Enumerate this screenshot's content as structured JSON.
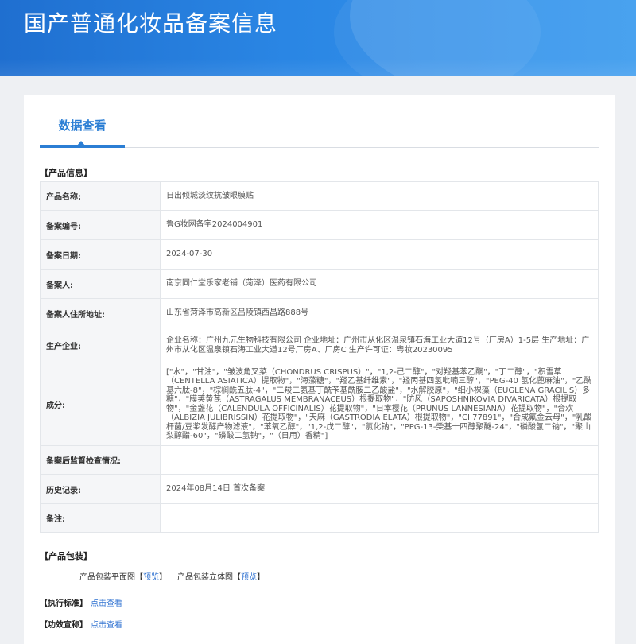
{
  "header": {
    "title": "国产普通化妆品备案信息"
  },
  "tabs": [
    {
      "label": "数据查看"
    }
  ],
  "product_info": {
    "section_title": "【产品信息】",
    "rows": [
      {
        "label": "产品名称:",
        "value": "日出倾城淡纹抗皱眼膜贴"
      },
      {
        "label": "备案编号:",
        "value": "鲁G妆网备字2024004901"
      },
      {
        "label": "备案日期:",
        "value": "2024-07-30"
      },
      {
        "label": "备案人:",
        "value": "南京同仁堂乐家老铺（菏泽）医药有限公司"
      },
      {
        "label": "备案人住所地址:",
        "value": "山东省菏泽市高新区吕陵镇西昌路888号"
      },
      {
        "label": "生产企业:",
        "value": "企业名称：广州九元生物科技有限公司 企业地址：广州市从化区温泉镇石海工业大道12号（厂房A）1-5层 生产地址：广州市从化区温泉镇石海工业大道12号厂房A、厂房C 生产许可证：粤妆20230095"
      },
      {
        "label": "成分:",
        "value": "[\"水\"，\"甘油\"，\"皱波角叉菜（CHONDRUS CRISPUS）\"，\"1,2-己二醇\"，\"对羟基苯乙酮\"，\"丁二醇\"，\"积雪草（CENTELLA ASIATICA）提取物\"，\"海藻糖\"，\"羟乙基纤维素\"，\"羟丙基四氢吡喃三醇\"，\"PEG-40 氢化蓖麻油\"，\"乙酰基六肽-8\"，\"棕榈酰五肽-4\"，\"二羧二氨基丁酰苄基酰胺二乙酸盐\"，\"水解胶原\"，\"细小裸藻（EUGLENA GRACILIS）多糖\"，\"膜荚黄芪（ASTRAGALUS MEMBRANACEUS）根提取物\"，\"防风（SAPOSHNIKOVIA DIVARICATA）根提取物\"，\"金盏花（CALENDULA OFFICINALIS）花提取物\"，\"日本樱花（PRUNUS LANNESIANA）花提取物\"，\"合欢（ALBIZIA JULIBRISSIN）花提取物\"，\"天麻（GASTRODIA ELATA）根提取物\"，\"CI 77891\"，\"合成氟金云母\"，\"乳酸杆菌/豆浆发酵产物滤液\"，\"苯氧乙醇\"，\"1,2-戊二醇\"，\"氯化钠\"，\"PPG-13-癸基十四醇聚醚-24\"，\"磷酸氢二钠\"，\"聚山梨醇酯-60\"，\"磷酸二氢钠\"，\"（日用）香精\"]"
      },
      {
        "label": "备案后监督检查情况:",
        "value": ""
      },
      {
        "label": "历史记录:",
        "value": "2024年08月14日 首次备案"
      },
      {
        "label": "备注:",
        "value": ""
      }
    ]
  },
  "packaging": {
    "section_title": "【产品包装】",
    "items": [
      {
        "label": "产品包装平面图",
        "bracket_open": "【",
        "link": "预览",
        "bracket_close": "】"
      },
      {
        "label": "产品包装立体图",
        "bracket_open": "【",
        "link": "预览",
        "bracket_close": "】"
      }
    ]
  },
  "standards": {
    "label": "【执行标准】",
    "link": "点击查看"
  },
  "claims": {
    "label": "【功效宣称】",
    "link": "点击查看"
  },
  "colors": {
    "banner": "#2a86e4",
    "accent": "#2b7ed4",
    "link": "#2b6fd0"
  }
}
